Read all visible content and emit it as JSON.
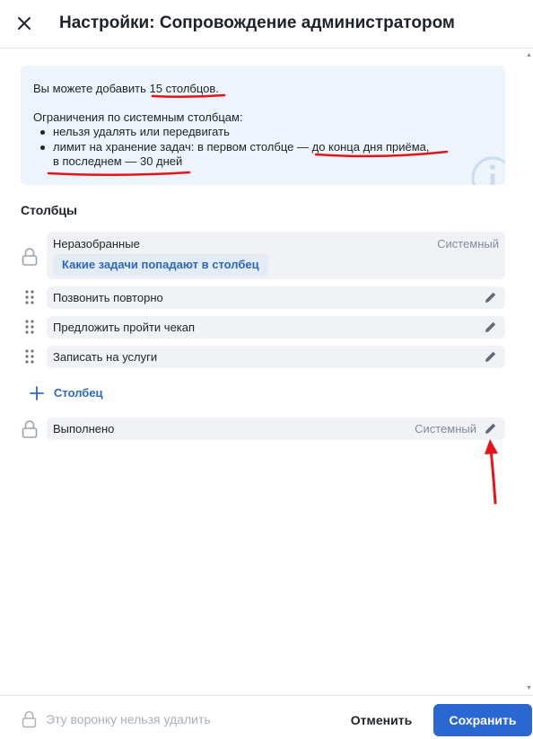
{
  "header": {
    "title": "Настройки: Сопровождение администратором"
  },
  "info": {
    "line1_prefix": "Вы можете добавить ",
    "line1_highlight": "15 столбцов",
    "line1_suffix": ".",
    "line2": "Ограничения по системным столбцам:",
    "bullet1": "нельзя удалять или передвигать",
    "bullet2_prefix": "лимит на хранение задач: в первом столбце — ",
    "bullet2_highlight1": "до конца дня приёма,",
    "bullet2_highlight2": "в последнем — 30 дней"
  },
  "columns_section": {
    "title": "Столбцы",
    "system_label": "Системный",
    "first": {
      "label": "Неразобранные",
      "chip": "Какие задачи попадают в столбец"
    },
    "items": [
      {
        "label": "Позвонить повторно"
      },
      {
        "label": "Предложить пройти чекап"
      },
      {
        "label": "Записать на услуги"
      }
    ],
    "add_label": "Столбец",
    "last": {
      "label": "Выполнено"
    }
  },
  "footer": {
    "note": "Эту воронку нельзя удалить",
    "cancel": "Отменить",
    "save": "Сохранить"
  },
  "colors": {
    "accent": "#2b67d1",
    "link": "#2d68c4",
    "annotation": "#e8131a",
    "info_bg": "#eef4fb",
    "row_bg": "#f0f2f5"
  }
}
